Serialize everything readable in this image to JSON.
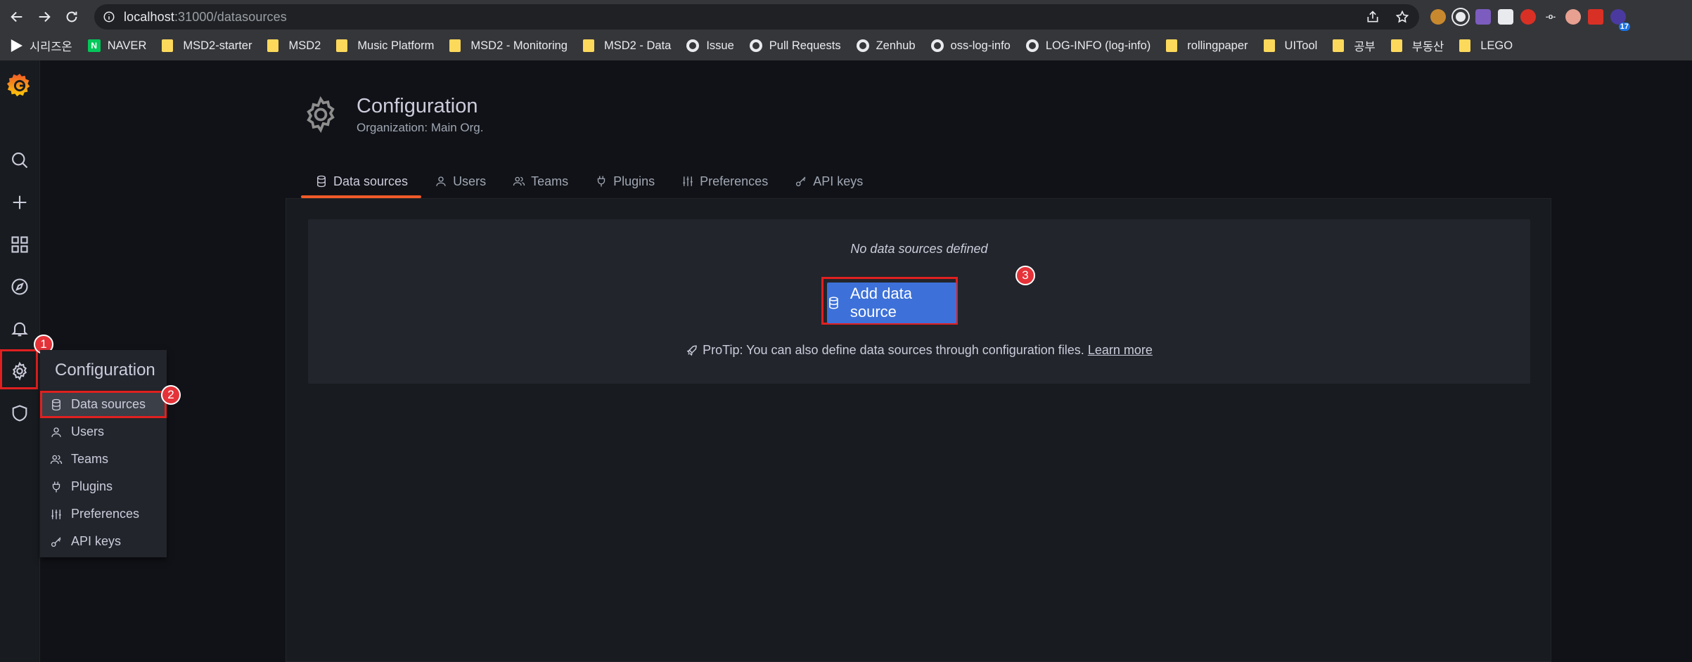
{
  "browser": {
    "url_host": "localhost",
    "url_rest": ":31000/datasources",
    "bookmarks": [
      {
        "label": "시리즈온",
        "kind": "play"
      },
      {
        "label": "NAVER",
        "kind": "naver"
      },
      {
        "label": "MSD2-starter",
        "kind": "folder"
      },
      {
        "label": "MSD2",
        "kind": "folder"
      },
      {
        "label": "Music Platform",
        "kind": "folder"
      },
      {
        "label": "MSD2 - Monitoring",
        "kind": "folder"
      },
      {
        "label": "MSD2 - Data",
        "kind": "folder"
      },
      {
        "label": "Issue",
        "kind": "github"
      },
      {
        "label": "Pull Requests",
        "kind": "github"
      },
      {
        "label": "Zenhub",
        "kind": "github"
      },
      {
        "label": "oss-log-info",
        "kind": "github"
      },
      {
        "label": "LOG-INFO (log-info)",
        "kind": "github"
      },
      {
        "label": "rollingpaper",
        "kind": "folder"
      },
      {
        "label": "UITool",
        "kind": "folder"
      },
      {
        "label": "공부",
        "kind": "folder"
      },
      {
        "label": "부동산",
        "kind": "folder"
      },
      {
        "label": "LEGO",
        "kind": "folder"
      }
    ],
    "extension_badge_count": "17"
  },
  "sidemenu": {
    "flyout_title": "Configuration",
    "flyout_items": [
      {
        "label": "Data sources",
        "icon": "database-icon"
      },
      {
        "label": "Users",
        "icon": "user-icon"
      },
      {
        "label": "Teams",
        "icon": "users-icon"
      },
      {
        "label": "Plugins",
        "icon": "plug-icon"
      },
      {
        "label": "Preferences",
        "icon": "sliders-icon"
      },
      {
        "label": "API keys",
        "icon": "key-icon"
      }
    ]
  },
  "annotations": {
    "step1": "1",
    "step2": "2",
    "step3": "3"
  },
  "page": {
    "title": "Configuration",
    "subtitle": "Organization: Main Org.",
    "tabs": [
      {
        "label": "Data sources",
        "active": true
      },
      {
        "label": "Users",
        "active": false
      },
      {
        "label": "Teams",
        "active": false
      },
      {
        "label": "Plugins",
        "active": false
      },
      {
        "label": "Preferences",
        "active": false
      },
      {
        "label": "API keys",
        "active": false
      }
    ],
    "empty_message": "No data sources defined",
    "add_button": "Add data source",
    "protip_text": "ProTip: You can also define data sources through configuration files.",
    "protip_link": "Learn more"
  },
  "colors": {
    "accent_tab": "#f05a28",
    "primary_button": "#3d71d9",
    "highlight": "#e02020"
  }
}
